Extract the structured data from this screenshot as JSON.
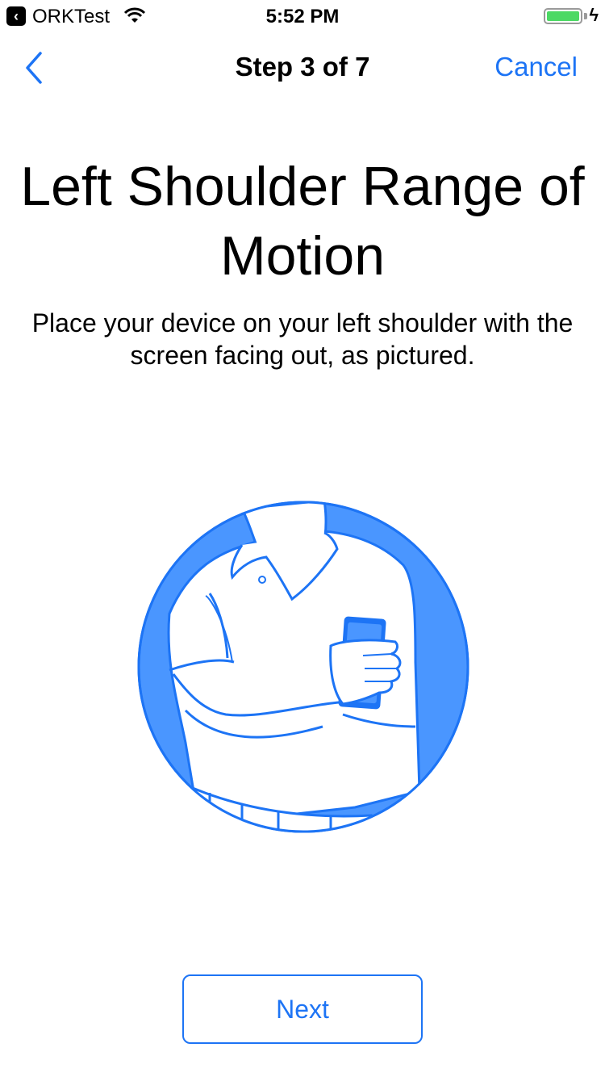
{
  "status_bar": {
    "app_name": "ORKTest",
    "time": "5:52 PM",
    "battery_level": 1.0
  },
  "nav": {
    "title": "Step 3 of 7",
    "cancel_label": "Cancel",
    "back_icon": "chevron-left-icon"
  },
  "content": {
    "title": "Left Shoulder Range of Motion",
    "description": "Place your device on your left shoulder with the screen facing out, as pictured."
  },
  "actions": {
    "next_label": "Next"
  },
  "colors": {
    "accent": "#1d74f5",
    "illustration_fill": "#4a96ff",
    "battery": "#4cd964"
  }
}
